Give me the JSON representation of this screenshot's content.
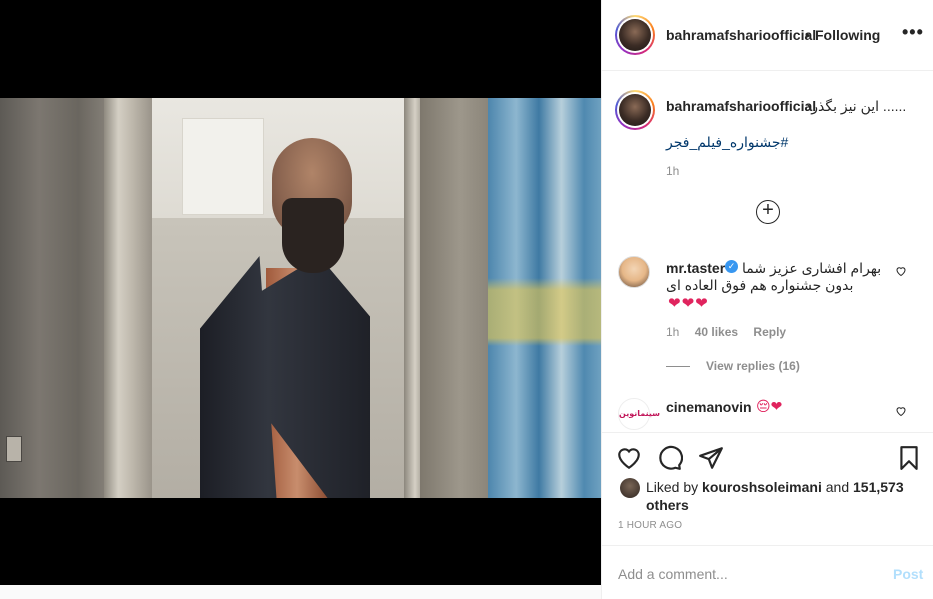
{
  "post": {
    "author": "bahramafsharioofficial",
    "follow_status": "Following",
    "dot": "•",
    "more_label": "•••"
  },
  "caption": {
    "user": "bahramafsharioofficial",
    "text": "...... این نیز بگذرد",
    "hashtag": "#جشنواره_فیلم_فجر",
    "time": "1h"
  },
  "load_more": "+",
  "comments": [
    {
      "user": "mr.taster",
      "verified": true,
      "line1": "بهرام افشاری عزیز شما",
      "line2": "بدون جشنواره هم فوق العاده ای",
      "hearts": "❤❤❤",
      "time": "1h",
      "likes": "40 likes",
      "reply": "Reply",
      "view_replies": "View replies (16)"
    },
    {
      "user": "cinemanovin",
      "emoji": "😔❤",
      "avatar_text": "سینمانوین"
    }
  ],
  "likes": {
    "prefix": "Liked by",
    "user": "kouroshsoleimani",
    "and": "and",
    "others": "151,573 others"
  },
  "timestamp": "1 HOUR AGO",
  "add_comment": {
    "placeholder": "Add a comment...",
    "post_label": "Post"
  },
  "colors": {
    "link": "#00376b",
    "verified": "#3897f0",
    "post_disabled": "#b2dffc"
  }
}
